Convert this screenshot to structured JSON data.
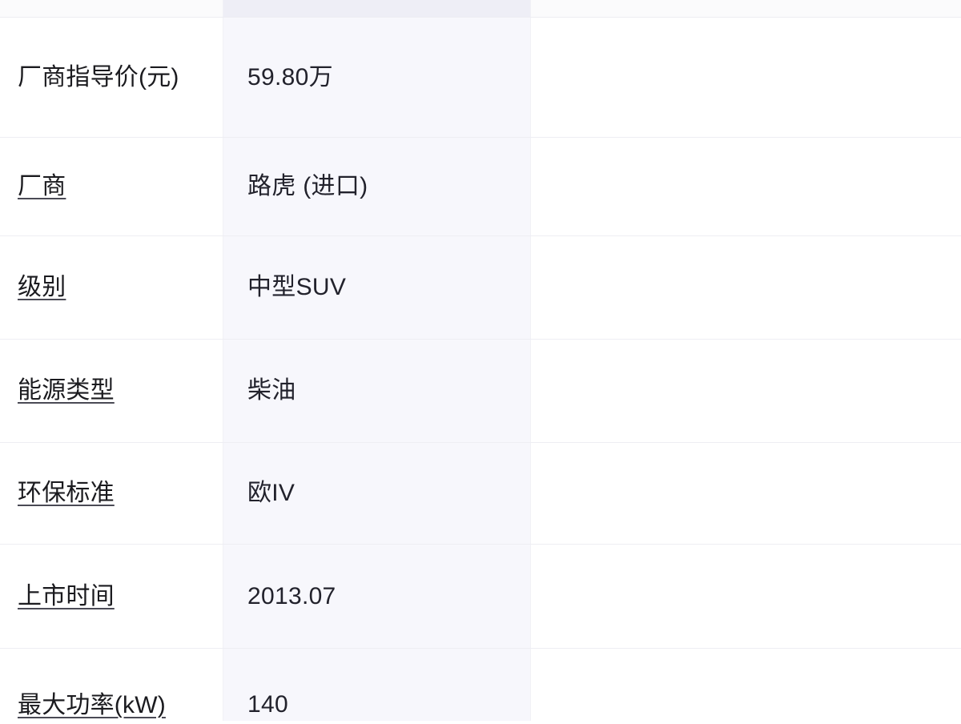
{
  "table": {
    "columns": [
      {
        "key": "param",
        "kind": "label-column"
      },
      {
        "key": "value",
        "kind": "value-column"
      },
      {
        "key": "compare",
        "kind": "empty-column"
      }
    ],
    "clipped_top_row": {
      "label": "",
      "value": ""
    },
    "rows": [
      {
        "label": "厂商指导价(元)",
        "value": "59.80万",
        "underlined": false
      },
      {
        "label": "厂商",
        "value": "路虎 (进口)",
        "underlined": true
      },
      {
        "label": "级别",
        "value": "中型SUV",
        "underlined": true
      },
      {
        "label": "能源类型",
        "value": "柴油",
        "underlined": true
      },
      {
        "label": "环保标准",
        "value": "欧IV",
        "underlined": true
      },
      {
        "label": "上市时间",
        "value": "2013.07",
        "underlined": true
      },
      {
        "label": "最大功率(kW)",
        "value": "140",
        "underlined": true
      }
    ]
  },
  "colors": {
    "page_background": "#ffffff",
    "label_column_background": "#ffffff",
    "value_column_background": "#f7f7fc",
    "row_divider": "#eeeef3",
    "label_text": "#1b1b1f",
    "value_text": "#22222c",
    "underline": "#4a4a55"
  }
}
